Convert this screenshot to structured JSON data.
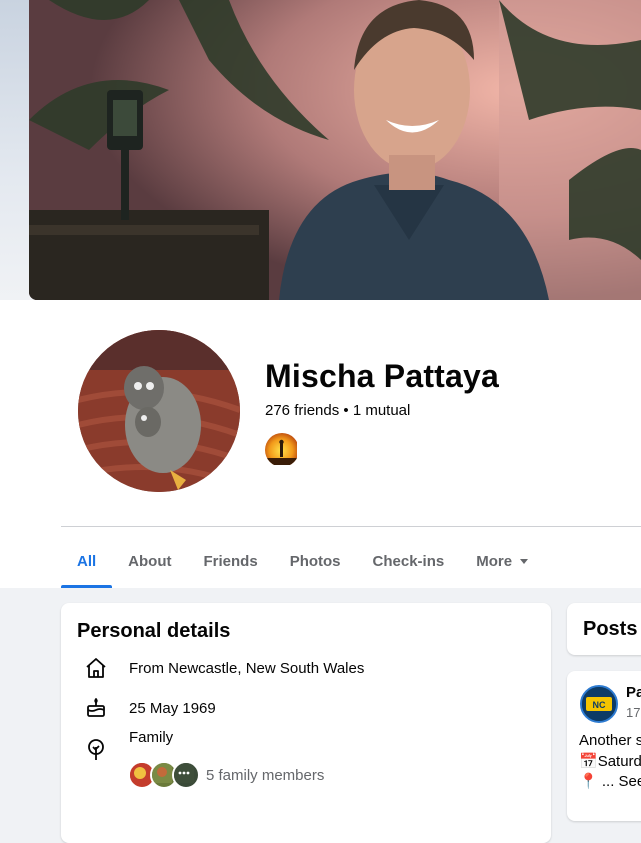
{
  "profile": {
    "name": "Mischa Pattaya",
    "friends_text": "276 friends",
    "separator": " • ",
    "mutual_text": "1 mutual"
  },
  "tabs": [
    {
      "label": "All",
      "active": true
    },
    {
      "label": "About"
    },
    {
      "label": "Friends"
    },
    {
      "label": "Photos"
    },
    {
      "label": "Check-ins"
    },
    {
      "label": "More"
    }
  ],
  "personal_details": {
    "title": "Personal details",
    "from": "From Newcastle, New South Wales",
    "birthday": "25 May 1969",
    "family_label": "Family",
    "family_members": "5 family members"
  },
  "posts": {
    "title": "Posts",
    "author_partial": "Pa",
    "time_partial": "17",
    "lines": [
      "Another s",
      "Saturda",
      "... See"
    ],
    "emoji_calendar": "📅",
    "emoji_pin": "📍"
  },
  "colors": {
    "accent": "#1b74e4",
    "secondary_text": "#65676b",
    "background": "#f0f2f5"
  }
}
